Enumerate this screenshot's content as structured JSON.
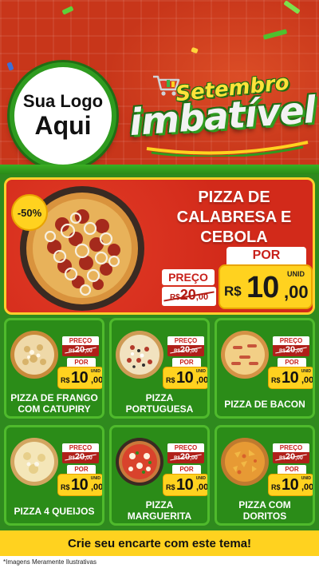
{
  "header": {
    "logo_line1": "Sua Logo",
    "logo_line2": "Aqui",
    "promo_word1": "Setembro",
    "promo_word2": "imbatível"
  },
  "featured": {
    "discount": "-50%",
    "name": "PIZZA DE CALABRESA E CEBOLA",
    "old_label": "PREÇO",
    "old_currency": "R$",
    "old_int": "20",
    "old_dec": ",00",
    "new_label": "POR",
    "unit": "UNID",
    "new_currency": "R$",
    "new_int": "10",
    "new_dec": ",00"
  },
  "products": [
    {
      "name": "PIZZA DE FRANGO COM CATUPIRY",
      "old_label": "PREÇO",
      "old_currency": "R$",
      "old_int": "20",
      "old_dec": ",00",
      "new_label": "POR",
      "unit": "UNID",
      "new_currency": "R$",
      "new_int": "10",
      "new_dec": ",00"
    },
    {
      "name": "PIZZA PORTUGUESA",
      "old_label": "PREÇO",
      "old_currency": "R$",
      "old_int": "20",
      "old_dec": ",00",
      "new_label": "POR",
      "unit": "UNID",
      "new_currency": "R$",
      "new_int": "10",
      "new_dec": ",00"
    },
    {
      "name": "PIZZA DE BACON",
      "old_label": "PREÇO",
      "old_currency": "R$",
      "old_int": "20",
      "old_dec": ",00",
      "new_label": "POR",
      "unit": "UNID",
      "new_currency": "R$",
      "new_int": "10",
      "new_dec": ",00"
    },
    {
      "name": "PIZZA 4 QUEIJOS",
      "old_label": "PREÇO",
      "old_currency": "R$",
      "old_int": "20",
      "old_dec": ",00",
      "new_label": "POR",
      "unit": "UNID",
      "new_currency": "R$",
      "new_int": "10",
      "new_dec": ",00"
    },
    {
      "name": "PIZZA MARGUERITA",
      "old_label": "PREÇO",
      "old_currency": "R$",
      "old_int": "20",
      "old_dec": ",00",
      "new_label": "POR",
      "unit": "UNID",
      "new_currency": "R$",
      "new_int": "10",
      "new_dec": ",00"
    },
    {
      "name": "PIZZA COM DORITOS",
      "old_label": "PREÇO",
      "old_currency": "R$",
      "old_int": "20",
      "old_dec": ",00",
      "new_label": "POR",
      "unit": "UNID",
      "new_currency": "R$",
      "new_int": "10",
      "new_dec": ",00"
    }
  ],
  "cta": "Crie seu encarte com este tema!",
  "disclaimer": "*Imagens Meramente Ilustrativas",
  "colors": {
    "header_red": "#c8361a",
    "green": "#2f8a1e",
    "yellow": "#ffd21f",
    "featured_red": "#d22a1a"
  },
  "icons": [
    "cart-icon",
    "pizza-image"
  ]
}
